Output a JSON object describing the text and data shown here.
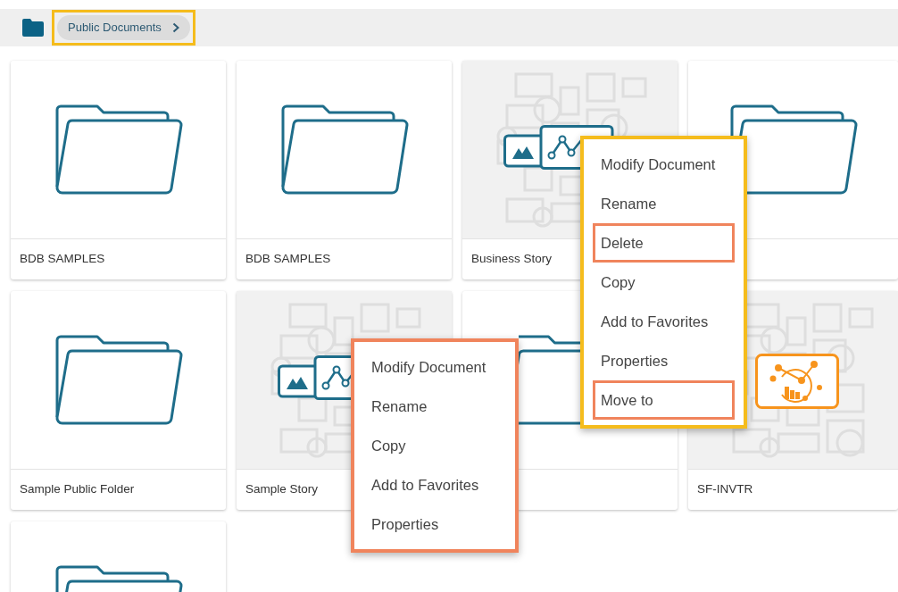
{
  "breadcrumb": {
    "label": "Public Documents",
    "highlighted": true
  },
  "cards": [
    {
      "kind": "folder",
      "label": "BDB SAMPLES"
    },
    {
      "kind": "folder",
      "label": "BDB SAMPLES"
    },
    {
      "kind": "story",
      "label": "Business Story"
    },
    {
      "kind": "folder"
    },
    {
      "kind": "folder",
      "label": "Sample Public Folder"
    },
    {
      "kind": "story",
      "label": "Sample Story"
    },
    {
      "kind": "folder"
    },
    {
      "kind": "dashboard",
      "label": "SF-INVTR"
    },
    {
      "kind": "folder"
    }
  ],
  "menus": [
    {
      "color": "#f5bc1c",
      "items": [
        {
          "label": "Modify Document",
          "highlighted": false
        },
        {
          "label": "Rename",
          "highlighted": false
        },
        {
          "label": "Delete",
          "highlighted": true
        },
        {
          "label": "Copy",
          "highlighted": false
        },
        {
          "label": "Add to Favorites",
          "highlighted": false
        },
        {
          "label": "Properties",
          "highlighted": false
        },
        {
          "label": "Move to",
          "highlighted": true
        }
      ]
    },
    {
      "color": "#f0845c",
      "items": [
        {
          "label": "Modify Document",
          "highlighted": false
        },
        {
          "label": "Rename",
          "highlighted": false
        },
        {
          "label": "Copy",
          "highlighted": false
        },
        {
          "label": "Add to Favorites",
          "highlighted": false
        },
        {
          "label": "Properties",
          "highlighted": false
        }
      ]
    }
  ]
}
